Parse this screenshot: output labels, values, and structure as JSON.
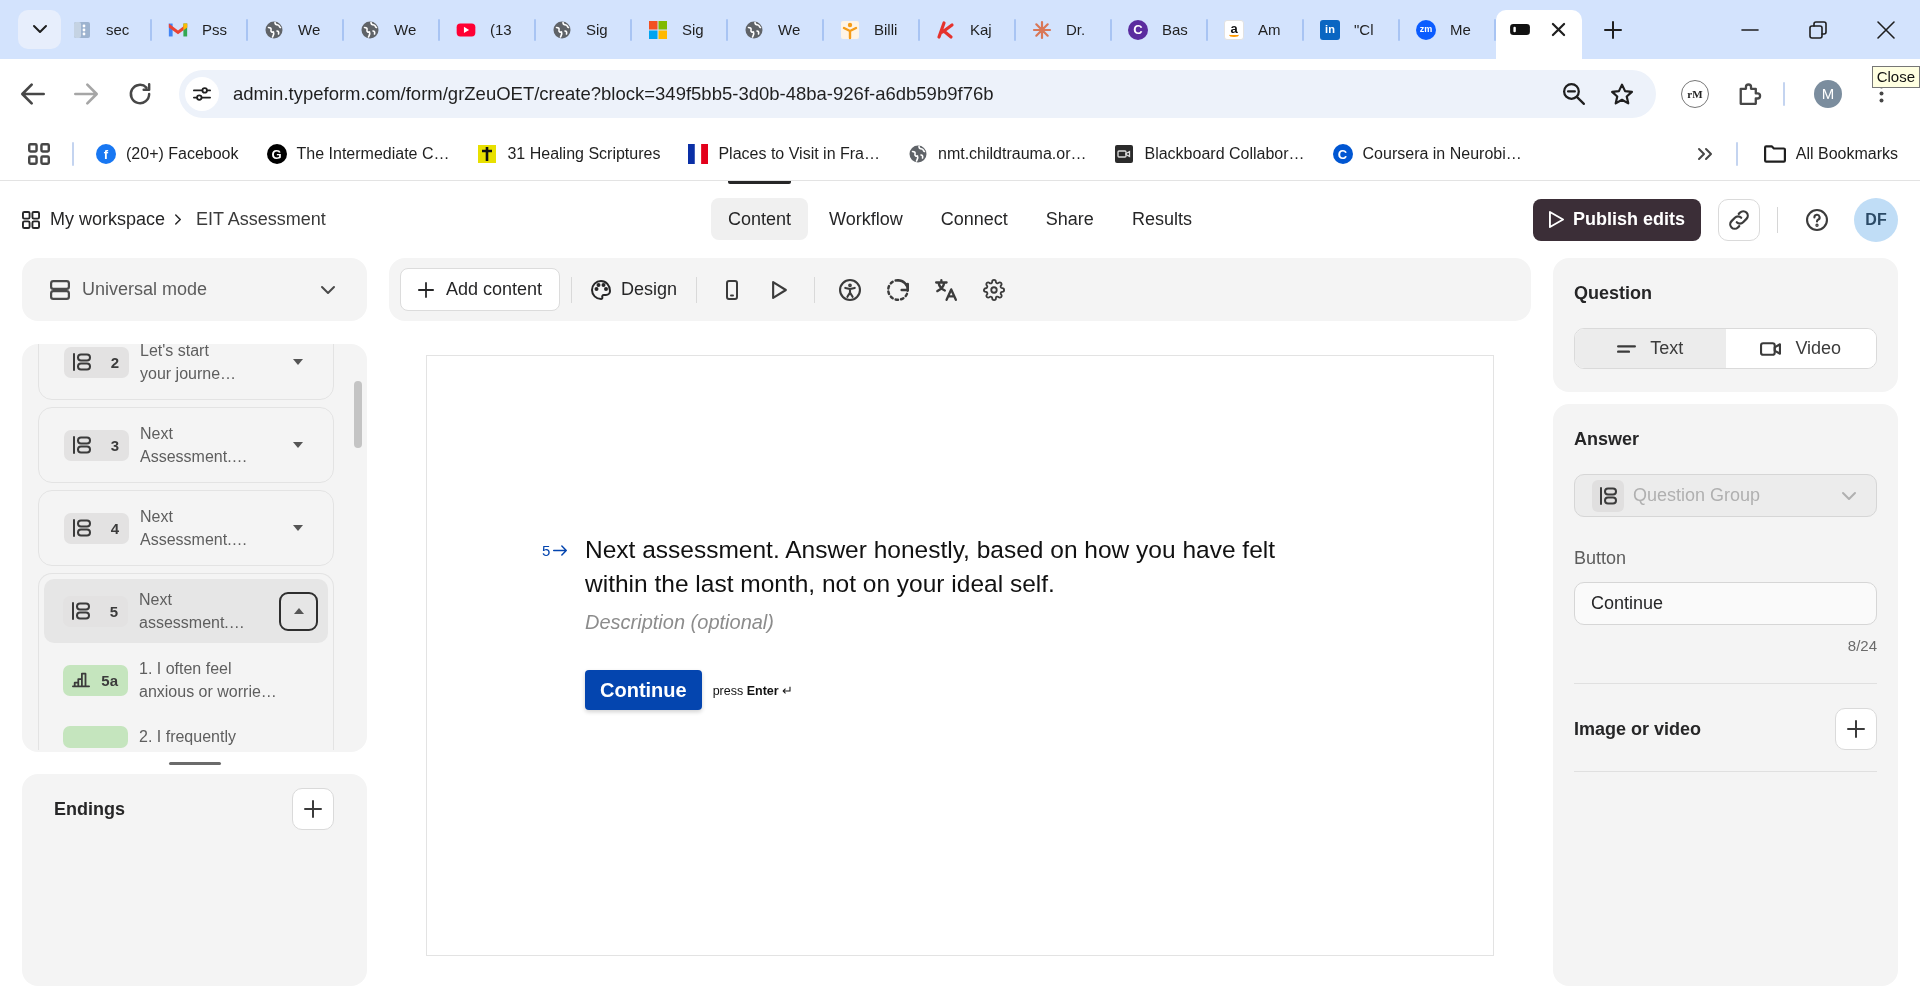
{
  "browser": {
    "tabs": [
      {
        "title": "sec",
        "kind": "doc",
        "selected": false
      },
      {
        "title": "Pss",
        "kind": "mail",
        "selected": false
      },
      {
        "title": "We",
        "kind": "globe",
        "selected": false
      },
      {
        "title": "We",
        "kind": "globe",
        "selected": false
      },
      {
        "title": "(13",
        "kind": "play",
        "selected": false
      },
      {
        "title": "Sig",
        "kind": "globe",
        "selected": false
      },
      {
        "title": "Sig",
        "kind": "squares",
        "selected": false
      },
      {
        "title": "We",
        "kind": "globe",
        "selected": false
      },
      {
        "title": "Billi",
        "kind": "figure",
        "selected": false
      },
      {
        "title": "Kaj",
        "kind": "slash",
        "selected": false
      },
      {
        "title": "Dr.",
        "kind": "asterisk",
        "selected": false
      },
      {
        "title": "Bas",
        "kind": "letter",
        "icon_text": "C",
        "color": "#5b2c9f",
        "selected": false
      },
      {
        "title": "Am",
        "kind": "smile",
        "icon_text": "a",
        "selected": false
      },
      {
        "title": "\"Cl",
        "kind": "tile",
        "icon_text": "in",
        "color": "#0a66c2",
        "selected": false
      },
      {
        "title": "Me",
        "kind": "letter",
        "icon_text": "zm",
        "color": "#0b5cff",
        "selected": false
      },
      {
        "kind": "pill",
        "selected": true
      }
    ],
    "tooltip": "Close",
    "url": "admin.typeform.com/form/grZeuOET/create?block=349f5bb5-3d0b-48ba-926f-a6db59b9f76b",
    "extensions": [
      {
        "kind": "badge",
        "label": "rM"
      },
      {
        "kind": "puzzle"
      }
    ],
    "profile": "M",
    "bookmarks": [
      {
        "title": "(20+) Facebook",
        "kind": "letter",
        "icon_text": "f",
        "color": "#1877f2"
      },
      {
        "title": "The Intermediate C…",
        "kind": "letter",
        "icon_text": "G",
        "color": "#000000"
      },
      {
        "title": "31 Healing Scriptures",
        "kind": "cross"
      },
      {
        "title": "Places to Visit in Fra…",
        "kind": "flag"
      },
      {
        "title": "nmt.childtrauma.or…",
        "kind": "globe"
      },
      {
        "title": "Blackboard Collabor…",
        "kind": "camera"
      },
      {
        "title": "Coursera in Neurobi…",
        "kind": "letter",
        "icon_text": "C",
        "color": "#0056d2"
      }
    ],
    "all_bookmarks": "All Bookmarks"
  },
  "header": {
    "breadcrumb": [
      "My workspace",
      "EIT Assessment"
    ],
    "nav": [
      {
        "label": "Content",
        "selected": true
      },
      {
        "label": "Workflow",
        "selected": false
      },
      {
        "label": "Connect",
        "selected": false
      },
      {
        "label": "Share",
        "selected": false
      },
      {
        "label": "Results",
        "selected": false
      }
    ],
    "publish": "Publish edits",
    "avatar": "DF"
  },
  "mode_select": {
    "value": "Universal mode"
  },
  "outline": {
    "items": [
      {
        "kind": "group",
        "number": "2",
        "title": "Let's start\nyour journe…",
        "expanded": false,
        "selected": false
      },
      {
        "kind": "group",
        "number": "3",
        "title": "Next\nAssessment.…",
        "expanded": false,
        "selected": false
      },
      {
        "kind": "group",
        "number": "4",
        "title": "Next\nAssessment.…",
        "expanded": false,
        "selected": false
      },
      {
        "kind": "group",
        "number": "5",
        "title": "Next\nassessment.…",
        "expanded": true,
        "selected": true,
        "children": [
          {
            "kind": "rating",
            "number": "5a",
            "title": "1. I often feel\nanxious or worrie…",
            "selected": false
          },
          {
            "kind": "rating",
            "title": "2. I frequently",
            "selected": false
          }
        ]
      }
    ]
  },
  "endings": {
    "title": "Endings"
  },
  "toolbar": {
    "add": "Add content",
    "design": "Design"
  },
  "canvas": {
    "question": {
      "number": "5",
      "text": "Next assessment. Answer honestly, based on how you have felt within the last month, not on your ideal self.",
      "description": {
        "placeholder": "Description (optional)"
      }
    },
    "button": "Continue",
    "hint": "press **Enter** ↵"
  },
  "question_panel": {
    "title": "Question",
    "formats": [
      {
        "label": "Text",
        "kind": "text",
        "selected": true
      },
      {
        "label": "Video",
        "kind": "video",
        "selected": false
      }
    ]
  },
  "answer_panel": {
    "title": "Answer",
    "type_select": {
      "value": "Question Group",
      "disabled": true
    },
    "button_field": {
      "label": "Button",
      "value": "Continue",
      "counter": "8/24"
    },
    "media": {
      "label": "Image or video"
    }
  }
}
